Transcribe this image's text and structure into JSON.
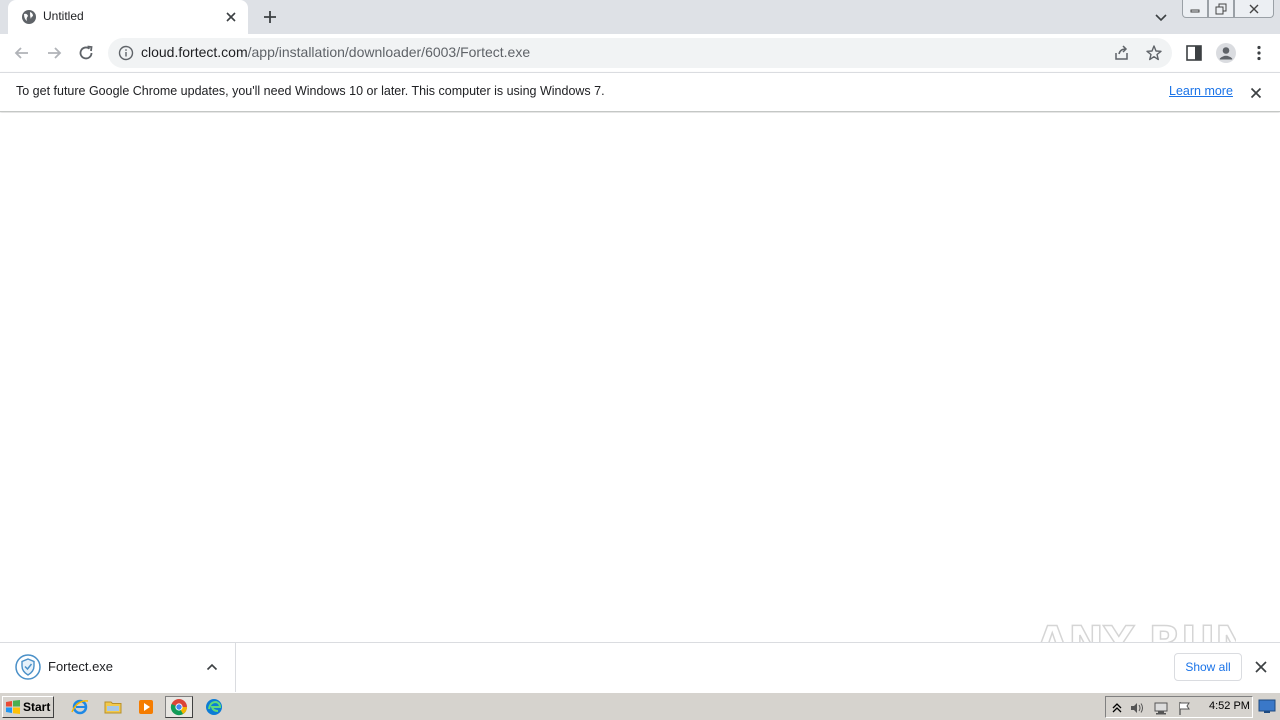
{
  "browser": {
    "tab": {
      "title": "Untitled"
    },
    "url": {
      "host": "cloud.fortect.com",
      "path": "/app/installation/downloader/6003/Fortect.exe"
    }
  },
  "infobar": {
    "message": "To get future Google Chrome updates, you'll need Windows 10 or later. This computer is using Windows 7.",
    "link": "Learn more"
  },
  "downloads": {
    "item": {
      "filename": "Fortect.exe"
    },
    "show_all": "Show all"
  },
  "watermark": {
    "text": "ANY RUN"
  },
  "taskbar": {
    "start_label": "Start",
    "clock": "4:52 PM"
  },
  "colors": {
    "tabstrip": "#dee1e6",
    "omnibox": "#f1f3f4",
    "link": "#1a73e8",
    "taskbar": "#d6d3ce"
  }
}
